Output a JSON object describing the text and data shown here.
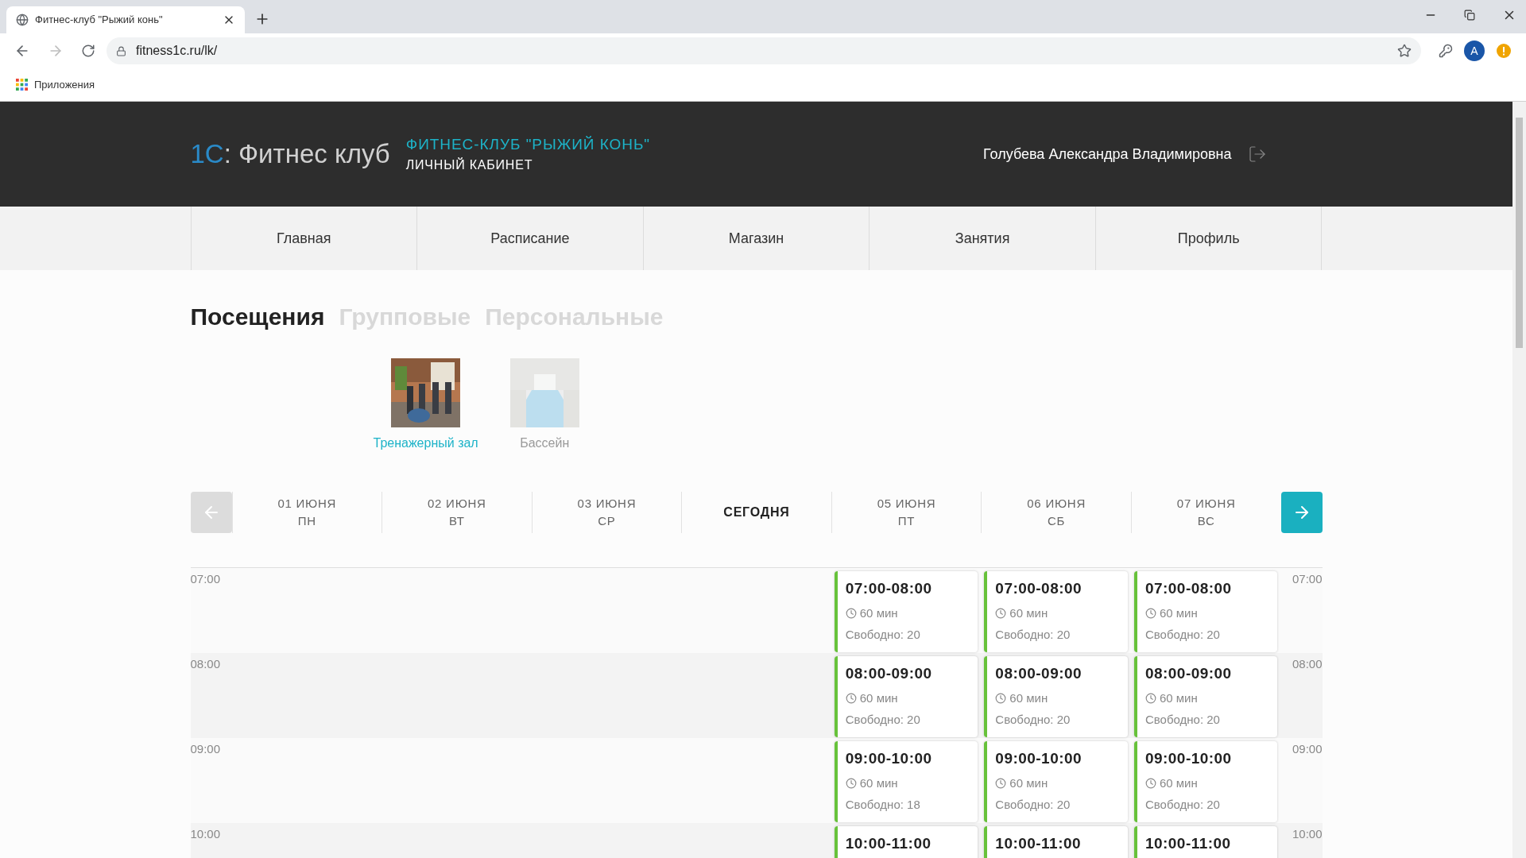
{
  "browser": {
    "tab_title": "Фитнес-клуб \"Рыжий конь\"",
    "url": "fitness1c.ru/lk/",
    "bookmarks": [
      "Приложения"
    ],
    "avatar": "A"
  },
  "header": {
    "logo_brand": "1С",
    "logo_text": ": Фитнес клуб",
    "club_name": "ФИТНЕС-КЛУБ \"РЫЖИЙ КОНЬ\"",
    "subtitle": "ЛИЧНЫЙ КАБИНЕТ",
    "user_name": "Голубева Александра Владимировна"
  },
  "nav": [
    "Главная",
    "Расписание",
    "Магазин",
    "Занятия",
    "Профиль"
  ],
  "section_tabs": [
    {
      "label": "Посещения",
      "selected": true
    },
    {
      "label": "Групповые",
      "selected": false
    },
    {
      "label": "Персональные",
      "selected": false
    }
  ],
  "rooms": [
    {
      "label": "Тренажерный зал",
      "kind": "gym",
      "selected": true
    },
    {
      "label": "Бассейн",
      "kind": "pool",
      "selected": false
    }
  ],
  "date_nav": {
    "prev_disabled": true,
    "next_disabled": false
  },
  "days": [
    {
      "date": "01 ИЮНЯ",
      "weekday": "ПН",
      "selected": false
    },
    {
      "date": "02 ИЮНЯ",
      "weekday": "ВТ",
      "selected": false
    },
    {
      "date": "03 ИЮНЯ",
      "weekday": "СР",
      "selected": false
    },
    {
      "date": "СЕГОДНЯ",
      "selected": true
    },
    {
      "date": "05 ИЮНЯ",
      "weekday": "ПТ",
      "selected": false
    },
    {
      "date": "06 ИЮНЯ",
      "weekday": "СБ",
      "selected": false
    },
    {
      "date": "07 ИЮНЯ",
      "weekday": "ВС",
      "selected": false
    }
  ],
  "schedule": [
    {
      "time": "07:00",
      "time_right": "07:00",
      "sessions": [
        {
          "time": "07:00-08:00",
          "duration": "60 мин",
          "free": "Свободно: 20"
        },
        {
          "time": "07:00-08:00",
          "duration": "60 мин",
          "free": "Свободно: 20"
        },
        {
          "time": "07:00-08:00",
          "duration": "60 мин",
          "free": "Свободно: 20"
        }
      ]
    },
    {
      "time": "08:00",
      "time_right": "08:00",
      "sessions": [
        {
          "time": "08:00-09:00",
          "duration": "60 мин",
          "free": "Свободно: 20"
        },
        {
          "time": "08:00-09:00",
          "duration": "60 мин",
          "free": "Свободно: 20"
        },
        {
          "time": "08:00-09:00",
          "duration": "60 мин",
          "free": "Свободно: 20"
        }
      ]
    },
    {
      "time": "09:00",
      "time_right": "09:00",
      "sessions": [
        {
          "time": "09:00-10:00",
          "duration": "60 мин",
          "free": "Свободно: 18"
        },
        {
          "time": "09:00-10:00",
          "duration": "60 мин",
          "free": "Свободно: 20"
        },
        {
          "time": "09:00-10:00",
          "duration": "60 мин",
          "free": "Свободно: 20"
        }
      ]
    },
    {
      "time": "10:00",
      "time_right": "10:00",
      "sessions": [
        {
          "time": "10:00-11:00"
        },
        {
          "time": "10:00-11:00"
        },
        {
          "time": "10:00-11:00"
        }
      ]
    }
  ]
}
